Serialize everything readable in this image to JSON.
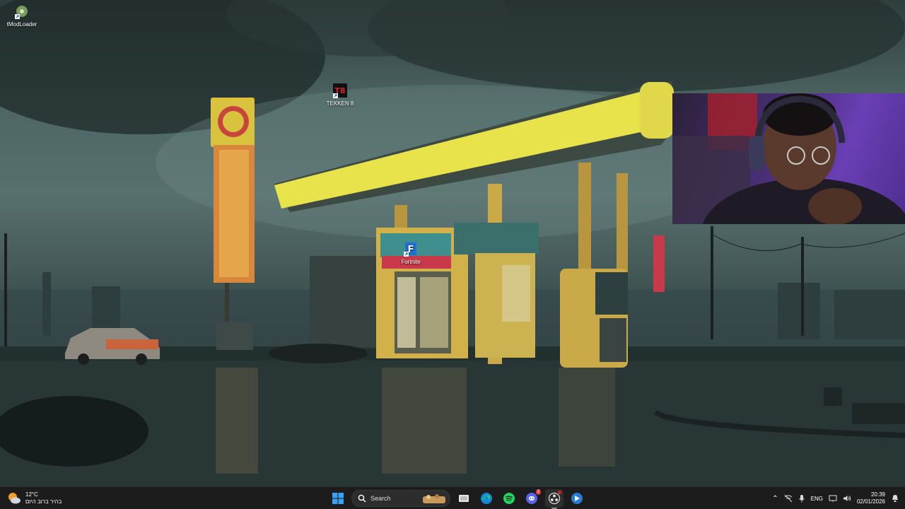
{
  "desktop": {
    "icons": [
      {
        "name": "tmodloader-shortcut",
        "label": "tModLoader",
        "icon": "tmodloader-icon"
      },
      {
        "name": "tekken8-shortcut",
        "label": "TEKKEN 8",
        "icon": "tekken8-icon"
      },
      {
        "name": "fortnite-shortcut",
        "label": "Fortnite",
        "icon": "fortnite-icon"
      }
    ]
  },
  "taskbar": {
    "weather": {
      "temperature": "12°C",
      "description": "בהיר ברוב היום"
    },
    "search": {
      "placeholder": "Search"
    },
    "apps": [
      {
        "name": "windows-start",
        "icon": "windows-logo-icon"
      },
      {
        "name": "task-view",
        "icon": "task-view-icon"
      },
      {
        "name": "edge",
        "icon": "edge-icon"
      },
      {
        "name": "spotify",
        "icon": "spotify-icon"
      },
      {
        "name": "discord",
        "icon": "discord-icon",
        "badge": "2"
      },
      {
        "name": "obs",
        "icon": "obs-icon"
      },
      {
        "name": "app-blue",
        "icon": "blue-app-icon"
      }
    ],
    "tray": {
      "language": "ENG",
      "time": "20:39",
      "date": "02/01/2026"
    }
  },
  "colors": {
    "taskbar": "#1c1c1c",
    "canopy": "#e8e34a",
    "webcam_bg": "#5a36a0"
  }
}
